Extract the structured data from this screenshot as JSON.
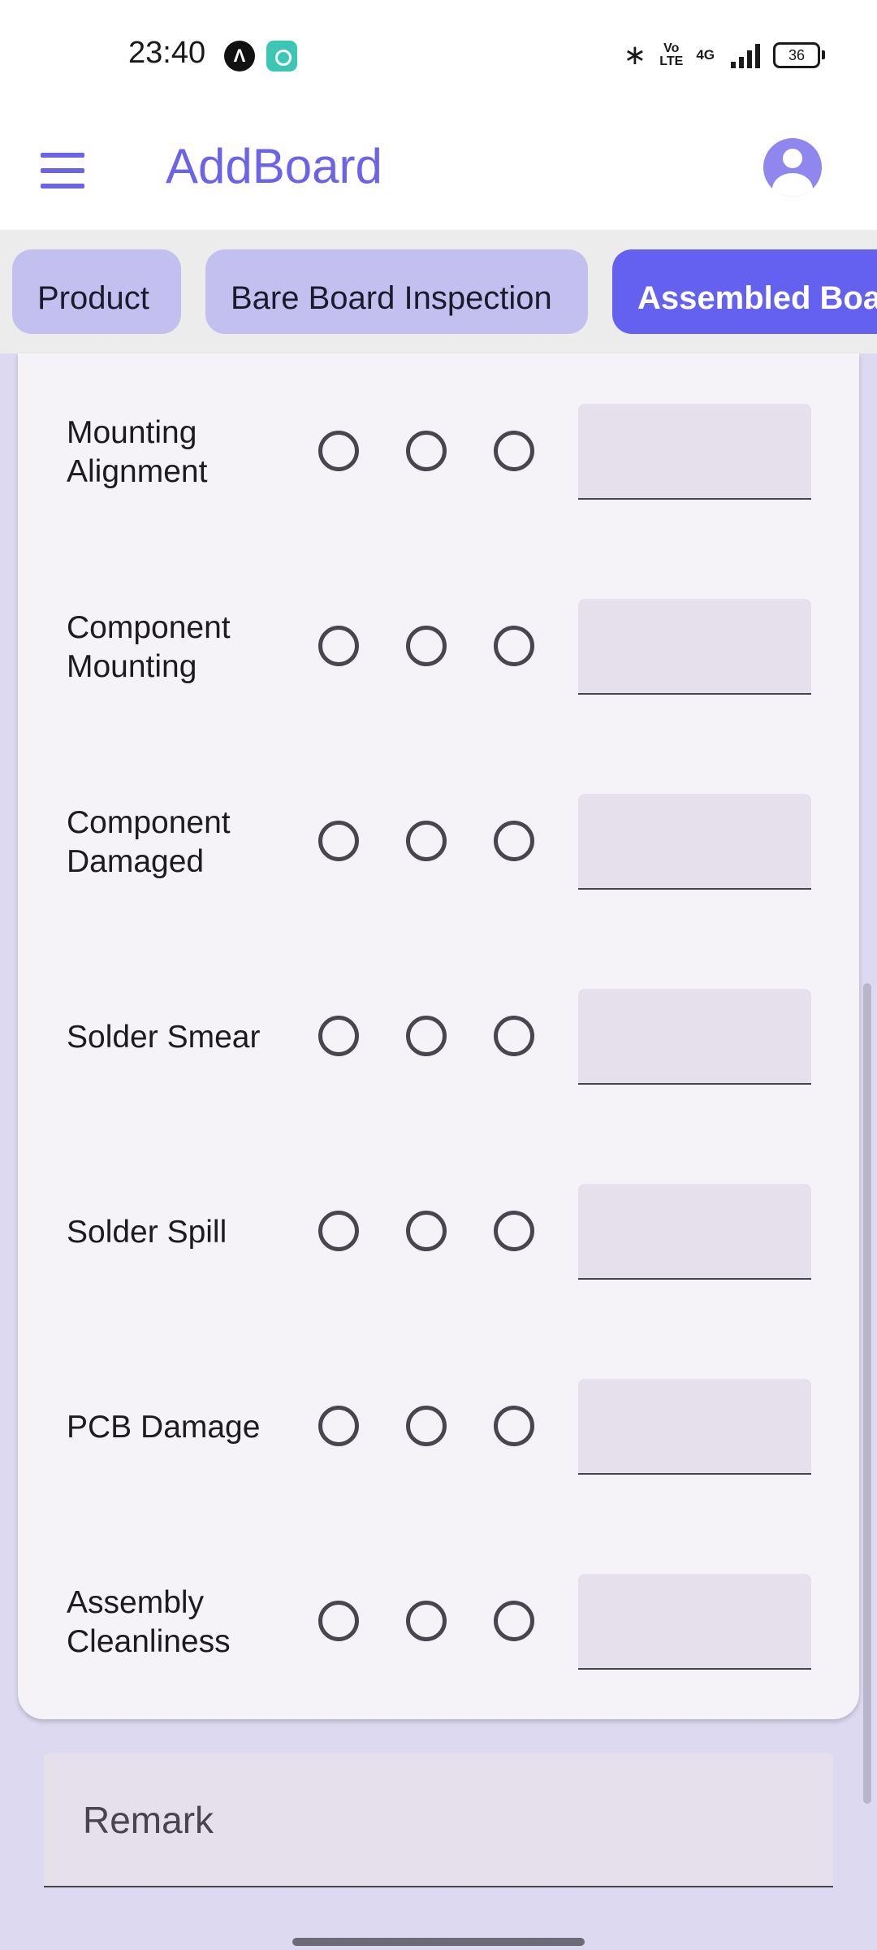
{
  "status_bar": {
    "time": "23:40",
    "network_4g": "4G",
    "volte_line1": "Vo",
    "volte_line2": "LTE",
    "battery": "36",
    "app_icon_1_glyph": "Λ",
    "icons": [
      "bluetooth-icon",
      "volte-icon",
      "4g-signal-icon",
      "signal-icon",
      "battery-icon"
    ]
  },
  "app_bar": {
    "title": "AddBoard",
    "menu_icon": "hamburger-menu-icon",
    "account_icon": "account-circle-icon"
  },
  "tabs": [
    {
      "label": "Product",
      "selected": false
    },
    {
      "label": "Bare Board Inspection",
      "selected": false
    },
    {
      "label": "Assembled Board",
      "selected": true
    }
  ],
  "inspection_rows": [
    {
      "label": "Mounting Alignment",
      "value": ""
    },
    {
      "label": "Component Mounting",
      "value": ""
    },
    {
      "label": "Component Damaged",
      "value": ""
    },
    {
      "label": "Solder Smear",
      "value": ""
    },
    {
      "label": "Solder Spill",
      "value": ""
    },
    {
      "label": "PCB Damage",
      "value": ""
    },
    {
      "label": "Assembly Cleanliness",
      "value": ""
    }
  ],
  "remark": {
    "label": "Remark",
    "value": ""
  },
  "colors": {
    "accent": "#6b63e8",
    "tab_selected": "#6561f0",
    "tab_unselected": "#c3c0f0",
    "card_bg": "#f5f2f8",
    "page_bg": "#dcd9f0",
    "field_bg": "#e6e0ec"
  }
}
